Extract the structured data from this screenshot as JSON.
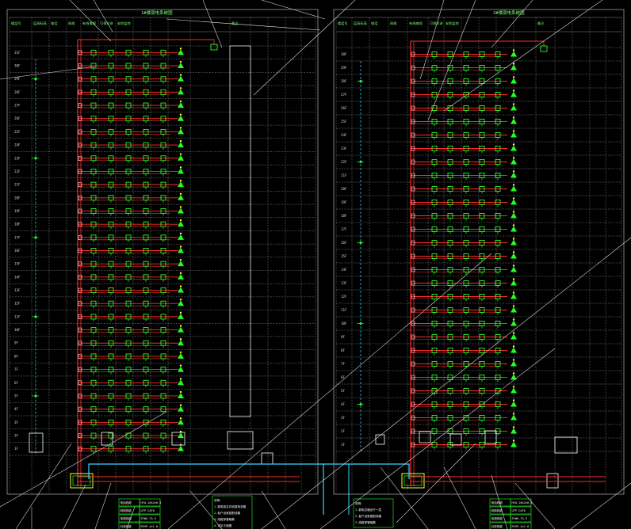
{
  "drawing": {
    "colors": {
      "background": "#000000",
      "grid": "#8a8a8a",
      "riser": "#ff2a2a",
      "device": "#22ff22",
      "cable": "#36d6ff",
      "text": "#d8d8d8",
      "highlight": "#ffff33",
      "border": "#ffffff",
      "overlay": "#e6e6e6"
    },
    "left_panel": {
      "title": "1#楼弱电系统图",
      "header_labels": [
        "楼层号",
        "层高标高",
        "电话",
        "网络",
        "有线电视",
        "可视对讲",
        "安防监控",
        "",
        "",
        "",
        "",
        "备注"
      ],
      "floor_labels": [
        "31F",
        "30F",
        "29F",
        "28F",
        "27F",
        "26F",
        "25F",
        "24F",
        "23F",
        "22F",
        "21F",
        "20F",
        "19F",
        "18F",
        "17F",
        "16F",
        "15F",
        "14F",
        "13F",
        "12F",
        "11F",
        "10F",
        "9F",
        "8F",
        "7F",
        "6F",
        "5F",
        "4F",
        "3F",
        "2F",
        "1F"
      ],
      "floor_count": 31,
      "device_columns": 6,
      "legend": [
        {
          "key": "电话线缆",
          "value": "HYA-10x2x0.5"
        },
        {
          "key": "网络线缆",
          "value": "UTP-CAT6"
        },
        {
          "key": "电视线缆",
          "value": "SYWV-75-5"
        },
        {
          "key": "对讲线缆",
          "value": "RVVP-4x1.0"
        }
      ],
      "notes": [
        "说明：",
        "1.弱电竖井内设弱电总箱",
        "2.各户设家居配线箱",
        "3.线缆穿管暗敷",
        "4.详见平面图"
      ]
    },
    "right_panel": {
      "title": "2#楼弱电系统图",
      "header_labels": [
        "楼层号",
        "层高标高",
        "电话",
        "网络",
        "有线电视",
        "可视对讲",
        "安防监控",
        "",
        "",
        "",
        "",
        "备注"
      ],
      "floor_labels": [
        "30F",
        "29F",
        "28F",
        "27F",
        "26F",
        "25F",
        "24F",
        "23F",
        "22F",
        "21F",
        "20F",
        "19F",
        "18F",
        "17F",
        "16F",
        "15F",
        "14F",
        "13F",
        "12F",
        "11F",
        "10F",
        "9F",
        "8F",
        "7F",
        "6F",
        "5F",
        "4F",
        "3F",
        "2F",
        "1F"
      ],
      "floor_count": 30,
      "device_columns": 6,
      "legend": [
        {
          "key": "电话线缆",
          "value": "HYA-10x2x0.5"
        },
        {
          "key": "网络线缆",
          "value": "UTP-CAT6"
        },
        {
          "key": "电视线缆",
          "value": "SYWV-75-5"
        },
        {
          "key": "对讲线缆",
          "value": "RVVP-4x1.0"
        }
      ],
      "notes": [
        "说明：",
        "1.弱电总箱设于一层",
        "2.各户设家居配线箱",
        "3.线缆穿管暗敷"
      ]
    }
  }
}
